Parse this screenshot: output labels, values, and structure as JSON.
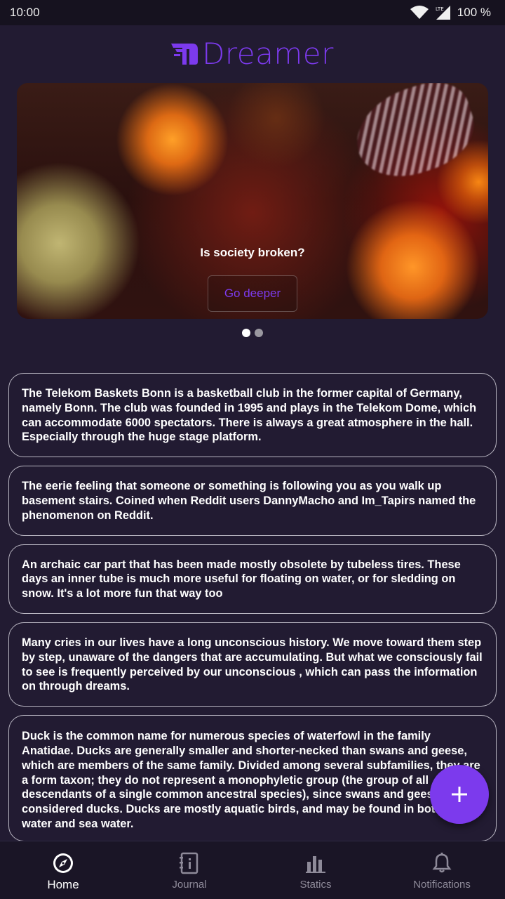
{
  "status_bar": {
    "time": "10:00",
    "network": "LTE",
    "battery": "100 %"
  },
  "app": {
    "logo_text": "Dreamer",
    "accent_color": "#7c3aed"
  },
  "hero": {
    "title": "Is society broken?",
    "button_label": "Go deeper",
    "page_count": 2,
    "active_page": 1
  },
  "cards": [
    {
      "text": "The Telekom Baskets Bonn is a basketball club in the former capital of Germany, namely Bonn. The club was founded in 1995 and plays in the Telekom Dome, which can accommodate 6000 spectators. There is always a great atmosphere in the hall. Especially through the huge stage platform."
    },
    {
      "text": "The eerie feeling that someone or something is following you as you walk up basement stairs. Coined when Reddit users DannyMacho and Im_Tapirs named the phenomenon on Reddit."
    },
    {
      "text": "An archaic car part that has been made mostly obsolete by tubeless tires. These days an inner tube is much more useful for floating on water, or for sledding on snow. It's a lot more fun that way too"
    },
    {
      "text": "Many cries in our lives have a long unconscious history. We move toward them step by step, unaware of the dangers that are accumulating. But what we consciously fail to see is frequently perceived by our  unconscious , which can pass the information on through dreams."
    },
    {
      "text": "Duck is the common name for numerous species of waterfowl in the family Anatidae. Ducks are generally smaller and shorter-necked than swans and geese, which are members of the same family. Divided among several subfamilies, they are a form taxon; they do not represent a monophyletic group (the group of all descendants of a single common ancestral species), since swans and geese are not considered ducks. Ducks are mostly aquatic birds, and may be found in both fresh water and sea water."
    }
  ],
  "fab": {
    "icon": "plus-icon"
  },
  "nav": {
    "items": [
      {
        "label": "Home",
        "icon": "compass-icon",
        "active": true
      },
      {
        "label": "Journal",
        "icon": "journal-icon",
        "active": false
      },
      {
        "label": "Statics",
        "icon": "bar-chart-icon",
        "active": false
      },
      {
        "label": "Notifications",
        "icon": "bell-icon",
        "active": false
      }
    ]
  }
}
